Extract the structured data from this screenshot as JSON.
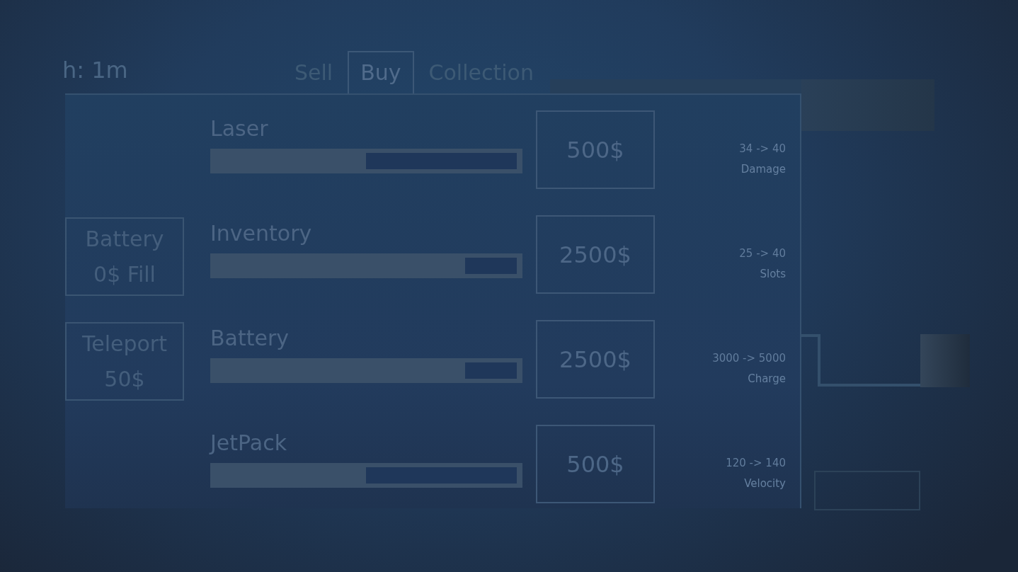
{
  "header": {
    "text": "h: 1m"
  },
  "tabs": [
    {
      "label": "Sell",
      "selected": false
    },
    {
      "label": "Buy",
      "selected": true
    },
    {
      "label": "Collection",
      "selected": false
    }
  ],
  "actions": [
    {
      "title": "Battery",
      "subtitle": "0$ Fill"
    },
    {
      "title": "Teleport",
      "subtitle": "50$"
    }
  ],
  "upgrades": [
    {
      "name": "Laser",
      "level": 0.5,
      "price": "500$",
      "change": "34 -> 40",
      "stat": "Damage"
    },
    {
      "name": "Inventory",
      "level": 0.83,
      "price": "2500$",
      "change": "25 -> 40",
      "stat": "Slots"
    },
    {
      "name": "Battery",
      "level": 0.83,
      "price": "2500$",
      "change": "3000 -> 5000",
      "stat": "Charge"
    },
    {
      "name": "JetPack",
      "level": 0.5,
      "price": "500$",
      "change": "120 -> 140",
      "stat": "Velocity"
    }
  ]
}
